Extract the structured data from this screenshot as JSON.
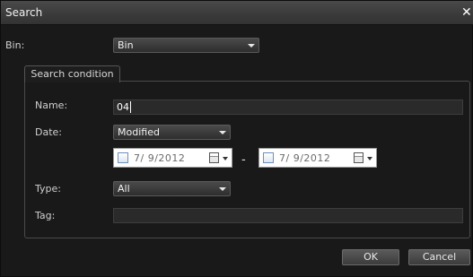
{
  "dialog": {
    "title": "Search",
    "close_glyph": "✕"
  },
  "bin": {
    "label": "Bin:",
    "value": "Bin"
  },
  "tabs": [
    {
      "label": "Search condition",
      "selected": true
    }
  ],
  "form": {
    "name_label": "Name:",
    "name_value": "04",
    "date_label": "Date:",
    "date_type": "Modified",
    "date_from": "7/ 9/2012",
    "date_separator": "-",
    "date_to": "7/ 9/2012",
    "type_label": "Type:",
    "type_value": "All",
    "tag_label": "Tag:",
    "tag_value": ""
  },
  "buttons": {
    "ok": "OK",
    "cancel": "Cancel"
  },
  "icons": {
    "close": "close-icon",
    "dropdown": "chevron-down-icon",
    "calendar": "calendar-icon",
    "checkbox": "checkbox-icon"
  },
  "colors": {
    "background": "#191919",
    "titlebar": "#3a3a3a",
    "field": "#2a2a2a",
    "text": "#d6d6d6"
  }
}
